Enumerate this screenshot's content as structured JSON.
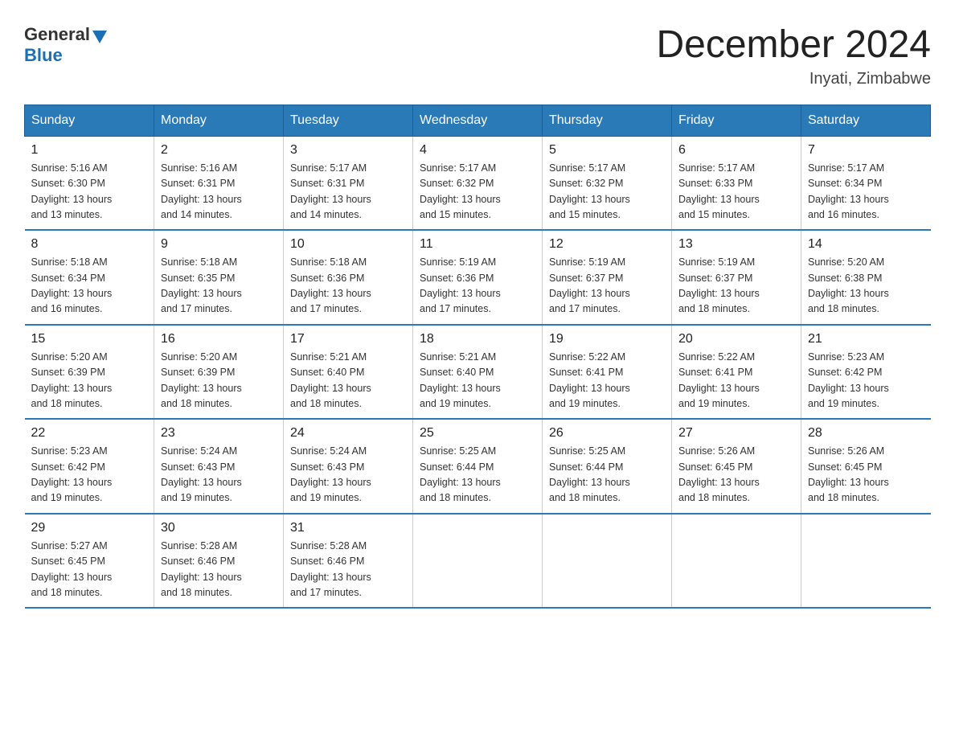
{
  "header": {
    "logo_general": "General",
    "logo_blue": "Blue",
    "month_title": "December 2024",
    "location": "Inyati, Zimbabwe"
  },
  "weekdays": [
    "Sunday",
    "Monday",
    "Tuesday",
    "Wednesday",
    "Thursday",
    "Friday",
    "Saturday"
  ],
  "weeks": [
    [
      {
        "day": "1",
        "sunrise": "5:16 AM",
        "sunset": "6:30 PM",
        "daylight": "13 hours and 13 minutes."
      },
      {
        "day": "2",
        "sunrise": "5:16 AM",
        "sunset": "6:31 PM",
        "daylight": "13 hours and 14 minutes."
      },
      {
        "day": "3",
        "sunrise": "5:17 AM",
        "sunset": "6:31 PM",
        "daylight": "13 hours and 14 minutes."
      },
      {
        "day": "4",
        "sunrise": "5:17 AM",
        "sunset": "6:32 PM",
        "daylight": "13 hours and 15 minutes."
      },
      {
        "day": "5",
        "sunrise": "5:17 AM",
        "sunset": "6:32 PM",
        "daylight": "13 hours and 15 minutes."
      },
      {
        "day": "6",
        "sunrise": "5:17 AM",
        "sunset": "6:33 PM",
        "daylight": "13 hours and 15 minutes."
      },
      {
        "day": "7",
        "sunrise": "5:17 AM",
        "sunset": "6:34 PM",
        "daylight": "13 hours and 16 minutes."
      }
    ],
    [
      {
        "day": "8",
        "sunrise": "5:18 AM",
        "sunset": "6:34 PM",
        "daylight": "13 hours and 16 minutes."
      },
      {
        "day": "9",
        "sunrise": "5:18 AM",
        "sunset": "6:35 PM",
        "daylight": "13 hours and 17 minutes."
      },
      {
        "day": "10",
        "sunrise": "5:18 AM",
        "sunset": "6:36 PM",
        "daylight": "13 hours and 17 minutes."
      },
      {
        "day": "11",
        "sunrise": "5:19 AM",
        "sunset": "6:36 PM",
        "daylight": "13 hours and 17 minutes."
      },
      {
        "day": "12",
        "sunrise": "5:19 AM",
        "sunset": "6:37 PM",
        "daylight": "13 hours and 17 minutes."
      },
      {
        "day": "13",
        "sunrise": "5:19 AM",
        "sunset": "6:37 PM",
        "daylight": "13 hours and 18 minutes."
      },
      {
        "day": "14",
        "sunrise": "5:20 AM",
        "sunset": "6:38 PM",
        "daylight": "13 hours and 18 minutes."
      }
    ],
    [
      {
        "day": "15",
        "sunrise": "5:20 AM",
        "sunset": "6:39 PM",
        "daylight": "13 hours and 18 minutes."
      },
      {
        "day": "16",
        "sunrise": "5:20 AM",
        "sunset": "6:39 PM",
        "daylight": "13 hours and 18 minutes."
      },
      {
        "day": "17",
        "sunrise": "5:21 AM",
        "sunset": "6:40 PM",
        "daylight": "13 hours and 18 minutes."
      },
      {
        "day": "18",
        "sunrise": "5:21 AM",
        "sunset": "6:40 PM",
        "daylight": "13 hours and 19 minutes."
      },
      {
        "day": "19",
        "sunrise": "5:22 AM",
        "sunset": "6:41 PM",
        "daylight": "13 hours and 19 minutes."
      },
      {
        "day": "20",
        "sunrise": "5:22 AM",
        "sunset": "6:41 PM",
        "daylight": "13 hours and 19 minutes."
      },
      {
        "day": "21",
        "sunrise": "5:23 AM",
        "sunset": "6:42 PM",
        "daylight": "13 hours and 19 minutes."
      }
    ],
    [
      {
        "day": "22",
        "sunrise": "5:23 AM",
        "sunset": "6:42 PM",
        "daylight": "13 hours and 19 minutes."
      },
      {
        "day": "23",
        "sunrise": "5:24 AM",
        "sunset": "6:43 PM",
        "daylight": "13 hours and 19 minutes."
      },
      {
        "day": "24",
        "sunrise": "5:24 AM",
        "sunset": "6:43 PM",
        "daylight": "13 hours and 19 minutes."
      },
      {
        "day": "25",
        "sunrise": "5:25 AM",
        "sunset": "6:44 PM",
        "daylight": "13 hours and 18 minutes."
      },
      {
        "day": "26",
        "sunrise": "5:25 AM",
        "sunset": "6:44 PM",
        "daylight": "13 hours and 18 minutes."
      },
      {
        "day": "27",
        "sunrise": "5:26 AM",
        "sunset": "6:45 PM",
        "daylight": "13 hours and 18 minutes."
      },
      {
        "day": "28",
        "sunrise": "5:26 AM",
        "sunset": "6:45 PM",
        "daylight": "13 hours and 18 minutes."
      }
    ],
    [
      {
        "day": "29",
        "sunrise": "5:27 AM",
        "sunset": "6:45 PM",
        "daylight": "13 hours and 18 minutes."
      },
      {
        "day": "30",
        "sunrise": "5:28 AM",
        "sunset": "6:46 PM",
        "daylight": "13 hours and 18 minutes."
      },
      {
        "day": "31",
        "sunrise": "5:28 AM",
        "sunset": "6:46 PM",
        "daylight": "13 hours and 17 minutes."
      },
      null,
      null,
      null,
      null
    ]
  ],
  "labels": {
    "sunrise": "Sunrise:",
    "sunset": "Sunset:",
    "daylight": "Daylight:"
  }
}
